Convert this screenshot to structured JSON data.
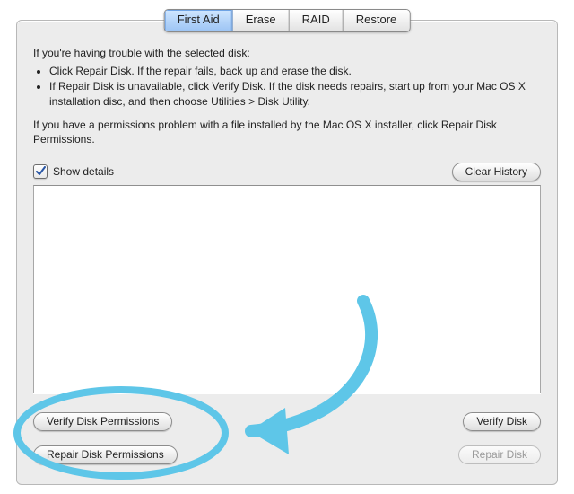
{
  "tabs": {
    "items": [
      "First Aid",
      "Erase",
      "RAID",
      "Restore"
    ],
    "selected": 0
  },
  "instructions": {
    "intro": "If you're having trouble with the selected disk:",
    "bullets": [
      "Click Repair Disk. If the repair fails, back up and erase the disk.",
      "If Repair Disk is unavailable, click Verify Disk. If the disk needs repairs, start up from your Mac OS X installation disc, and then choose Utilities > Disk Utility."
    ],
    "permissions": "If you have a permissions problem with a file installed by the Mac OS X installer, click Repair Disk Permissions."
  },
  "details": {
    "show_label": "Show details",
    "checked": true,
    "clear_history_label": "Clear History"
  },
  "buttons": {
    "verify_permissions": "Verify Disk Permissions",
    "repair_permissions": "Repair Disk Permissions",
    "verify_disk": "Verify Disk",
    "repair_disk": "Repair Disk",
    "repair_disk_enabled": false
  },
  "annotation": {
    "color": "#5ec6e8"
  }
}
